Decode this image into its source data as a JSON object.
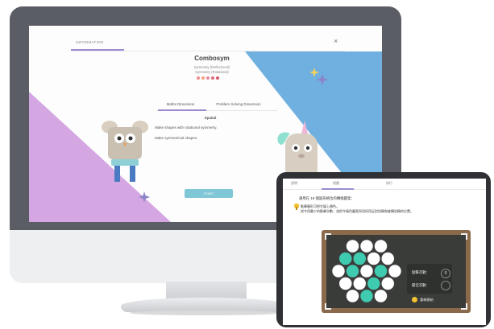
{
  "desktop": {
    "tab_label": "INFORMATION",
    "close_glyph": "×",
    "title": "Combosym",
    "subtitle_1": "Symmetry (Reflectional)",
    "subtitle_2": "Symmetry (Rotational)",
    "rating_dots": [
      "#f28a8a",
      "#f2a07a",
      "#e88aa0",
      "#e06a7a",
      "#d85a6a"
    ],
    "tabs": [
      "Maths Dimension",
      "Problem Solving Dimension"
    ],
    "section_title": "Spatial",
    "descriptions": [
      "Make shapes with rotational symmetry.",
      "Make symmetrical shapes."
    ],
    "start_button": "START"
  },
  "tablet": {
    "tabs": [
      "說明",
      "遊戲",
      "排行"
    ],
    "question": "運用在 19 個圓形格位的轉換圖案：",
    "hint_lines": [
      "點擊圓形可把它填上顏色。",
      "試今用最少的點擊次數，並把今填色圖案所用所用足對對稱和旋轉對稱的位置。"
    ],
    "click_count_label": "點擊次數：",
    "click_count_value": "0",
    "best_label": "最佳次數：",
    "best_value": "",
    "reset_label": "重新開始",
    "filled_cells": [
      3,
      4,
      8,
      10,
      14,
      17
    ],
    "colors": {
      "filled": "#3fcbb0",
      "empty": "#ffffff"
    }
  }
}
